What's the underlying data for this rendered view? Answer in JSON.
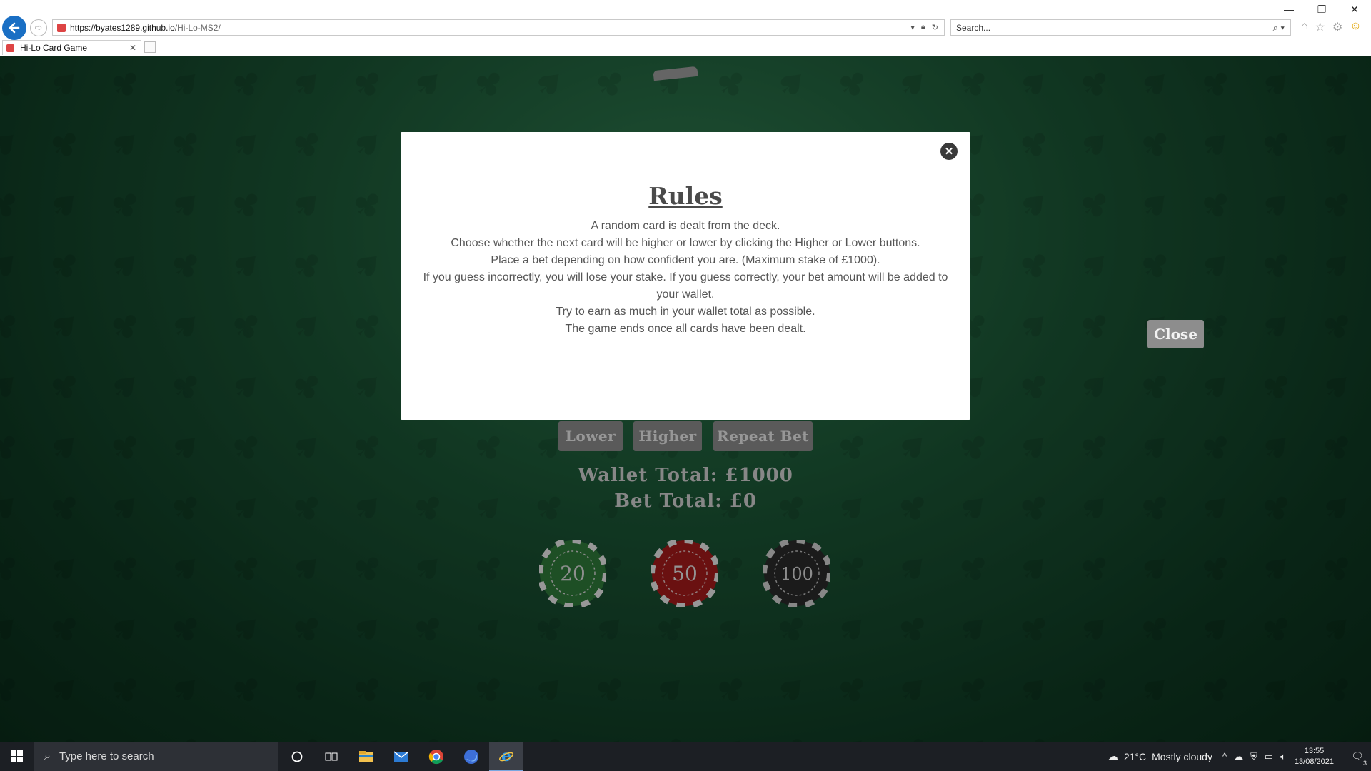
{
  "browser": {
    "window_controls": [
      "—",
      "❐",
      "✕"
    ],
    "url_host": "https://byates1289.github.io",
    "url_path": "/Hi-Lo-MS2/",
    "search_placeholder": "Search...",
    "tab_title": "Hi-Lo Card Game",
    "icons": [
      "back-arrow-icon",
      "forward-arrow-icon",
      "lock-icon",
      "refresh-icon",
      "search-icon",
      "home-icon",
      "star-icon",
      "gear-icon",
      "smiley-icon"
    ]
  },
  "modal": {
    "title": "Rules",
    "lines": [
      "A random card is dealt from the deck.",
      "Choose whether the next card will be higher or lower by clicking the Higher or Lower buttons.",
      "Place a bet depending on how confident you are. (Maximum stake of £1000).",
      "If you guess incorrectly, you will lose your stake. If you guess correctly, your bet amount will be added to your wallet.",
      "Try to earn as much in your wallet total as possible.",
      "The game ends once all cards have been dealt."
    ],
    "close_icon": "close-icon"
  },
  "game": {
    "close_label": "Close",
    "lower_label": "Lower",
    "higher_label": "Higher",
    "repeat_label": "Repeat Bet",
    "wallet_text": "Wallet Total: £1000",
    "bet_text": "Bet Total: £0",
    "chips": [
      {
        "value": "20",
        "color": "#2e7a3a"
      },
      {
        "value": "50",
        "color": "#a31b1b"
      },
      {
        "value": "100",
        "color": "#2a2a2a"
      }
    ]
  },
  "taskbar": {
    "search_placeholder": "Type here to search",
    "weather_temp": "21°C",
    "weather_desc": "Mostly cloudy",
    "time": "13:55",
    "date": "13/08/2021",
    "notification_count": "3"
  }
}
